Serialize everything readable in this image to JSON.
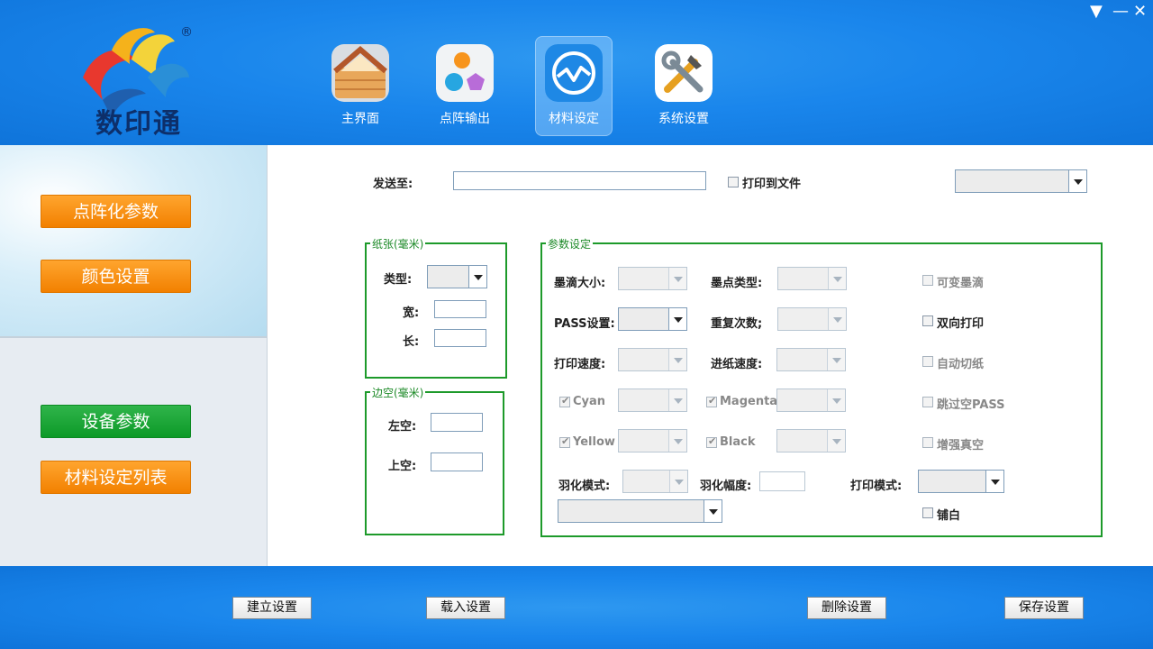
{
  "window": {
    "menu_icon": "▼",
    "minimize_icon": "—",
    "close_icon": "✕"
  },
  "logo": {
    "text": "数印通",
    "reg": "®"
  },
  "nav": {
    "items": [
      {
        "label": "主界面",
        "icon": "house-icon"
      },
      {
        "label": "点阵输出",
        "icon": "dots-icon"
      },
      {
        "label": "材料设定",
        "icon": "wave-icon",
        "active": true
      },
      {
        "label": "系统设置",
        "icon": "tools-icon"
      }
    ]
  },
  "sidebar": {
    "items": [
      {
        "label": "点阵化参数",
        "color": "#f28000"
      },
      {
        "label": "颜色设置",
        "color": "#f28000"
      },
      {
        "label": "设备参数",
        "color": "#0d9a28"
      },
      {
        "label": "材料设定列表",
        "color": "#f28000"
      }
    ]
  },
  "top": {
    "send_to_label": "发送至:",
    "send_to_value": "",
    "print_to_file_label": "打印到文件",
    "print_to_file_checked": false,
    "right_combo_value": ""
  },
  "paper": {
    "title": "纸张(毫米)",
    "type_label": "类型:",
    "type_value": "",
    "width_label": "宽:",
    "width_value": "",
    "length_label": "长:",
    "length_value": ""
  },
  "margin": {
    "title": "边空(毫米)",
    "left_label": "左空:",
    "left_value": "",
    "top_label": "上空:",
    "top_value": ""
  },
  "params": {
    "title": "参数设定",
    "drop_size": "墨滴大小:",
    "dot_type": "墨点类型:",
    "variable_drop": "可变墨滴",
    "pass": "PASS设置:",
    "repeat": "重复次数;",
    "bidirectional": "双向打印",
    "print_speed": "打印速度:",
    "feed_speed": "进纸速度:",
    "auto_cut": "自动切纸",
    "cyan": "Cyan",
    "magenta": "Magenta",
    "skip_pass": "跳过空PASS",
    "yellow": "Yellow",
    "black": "Black",
    "vacuum": "增强真空",
    "feather_mode": "羽化模式:",
    "feather_amp": "羽化幅度:",
    "print_mode": "打印模式:",
    "white": "铺白"
  },
  "footer": {
    "create": "建立设置",
    "load": "载入设置",
    "delete": "删除设置",
    "save": "保存设置"
  }
}
